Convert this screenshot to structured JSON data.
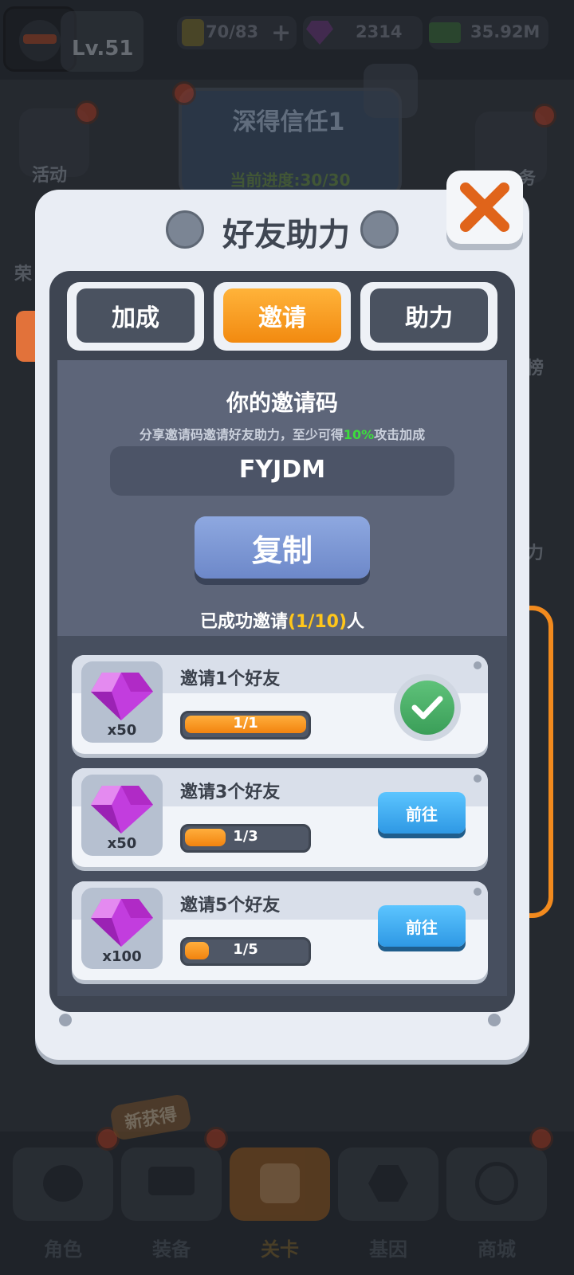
{
  "top_bar": {
    "level": "Lv.51",
    "energy": "70/83",
    "gems": "2314",
    "cash": "35.92M"
  },
  "quest": {
    "title": "深得信任1",
    "progress": "当前进度:30/30"
  },
  "side": {
    "left_activity": "活动",
    "left_partial": "荣",
    "right_task_partial": "务",
    "right_partial_1": "榜",
    "right_partial_2": "力"
  },
  "bottom_nav": {
    "badge_new": "新获得",
    "items": [
      "角色",
      "装备",
      "关卡",
      "基因",
      "商城"
    ]
  },
  "modal": {
    "title": "好友助力",
    "tabs": [
      "加成",
      "邀请",
      "助力"
    ],
    "active_tab": 1,
    "invite": {
      "heading": "你的邀请码",
      "desc_prefix": "分享邀请码邀请好友助力，至少可得",
      "desc_percent": "10%",
      "desc_suffix": "攻击加成",
      "code": "FYJDM",
      "copy_label": "复制",
      "success_prefix": "已成功邀请",
      "success_count": "(1/10)",
      "success_suffix": "人"
    },
    "rewards": [
      {
        "title": "邀请1个好友",
        "qty": "x50",
        "progress_text": "1/1",
        "progress": 1.0,
        "state": "done"
      },
      {
        "title": "邀请3个好友",
        "qty": "x50",
        "progress_text": "1/3",
        "progress": 0.333,
        "state": "go",
        "button": "前往"
      },
      {
        "title": "邀请5个好友",
        "qty": "x100",
        "progress_text": "1/5",
        "progress": 0.2,
        "state": "go",
        "button": "前往"
      }
    ]
  },
  "colors": {
    "accent_orange": "#f59b17",
    "gem_purple": "#c23dde",
    "success_green": "#3ddc3d",
    "go_blue": "#2e98e4"
  }
}
